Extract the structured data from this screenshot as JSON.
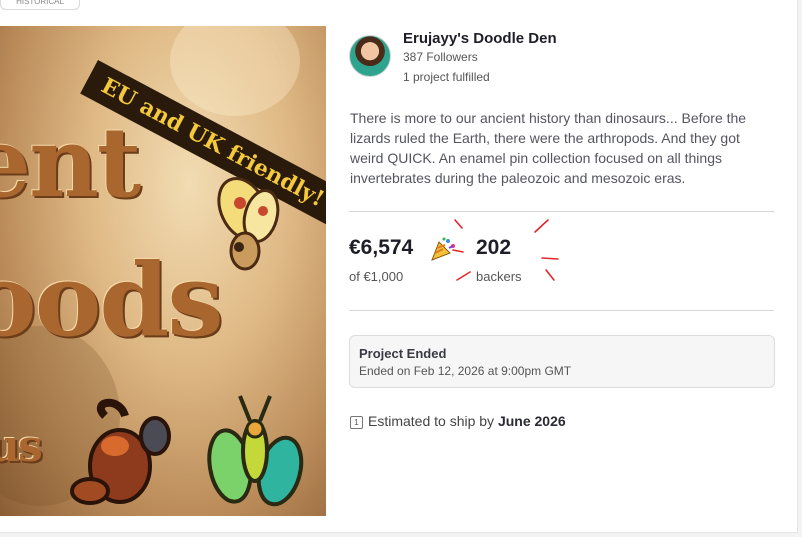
{
  "top_chip": {
    "label": "HISTORICAL"
  },
  "hero": {
    "banner_text": "EU and UK friendly!",
    "title_fragments": [
      "ent",
      "oods",
      "us"
    ]
  },
  "creator": {
    "name": "Erujayy's Doodle Den",
    "followers": "387 Followers",
    "projects": "1 project fulfilled"
  },
  "description": "There is more to our ancient history than dinosaurs... Before the lizards ruled the Earth, there were the arthropods. And they got weird QUICK. An enamel pin collection focused on all things invertebrates during the paleozoic and mesozoic eras.",
  "stats": {
    "pledged": "€6,574",
    "goal": "of €1,000",
    "backers_count": "202",
    "backers_label": "backers"
  },
  "status": {
    "title": "Project Ended",
    "date": "Ended on Feb 12, 2026 at 9:00pm GMT"
  },
  "shipping": {
    "prefix": "Estimated to ship by",
    "date": "June 2026"
  },
  "colors": {
    "annotation_red": "#e3262b",
    "banner_bg": "#2a1a0c",
    "banner_text": "#f4c93b"
  }
}
